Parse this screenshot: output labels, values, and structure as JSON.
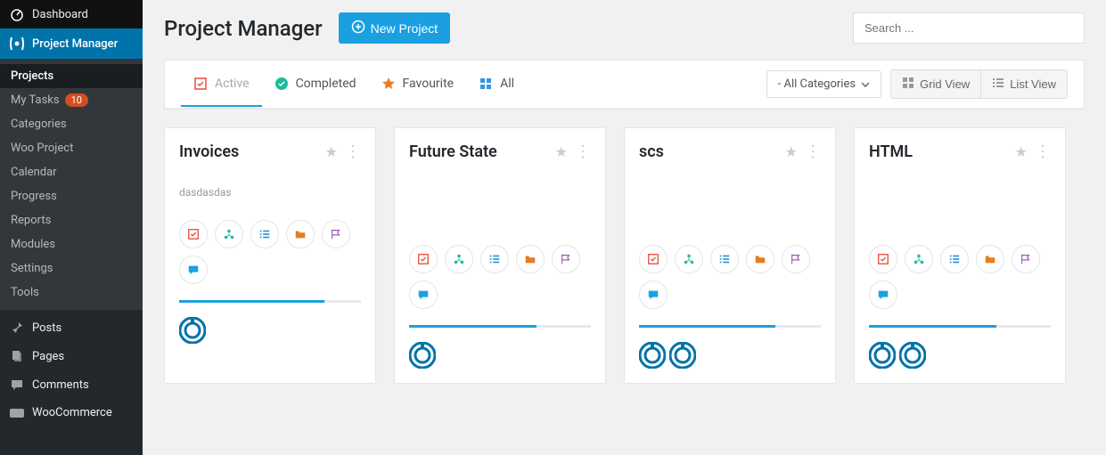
{
  "sidebar": {
    "dashboard": "Dashboard",
    "pm": "Project Manager",
    "sub": [
      {
        "label": "Projects",
        "active": true
      },
      {
        "label": "My Tasks",
        "badge": "10"
      },
      {
        "label": "Categories"
      },
      {
        "label": "Woo Project"
      },
      {
        "label": "Calendar"
      },
      {
        "label": "Progress"
      },
      {
        "label": "Reports"
      },
      {
        "label": "Modules"
      },
      {
        "label": "Settings"
      },
      {
        "label": "Tools"
      }
    ],
    "bottom": [
      {
        "label": "Posts"
      },
      {
        "label": "Pages"
      },
      {
        "label": "Comments"
      },
      {
        "label": "WooCommerce"
      }
    ]
  },
  "header": {
    "title": "Project Manager",
    "new_btn": "New Project",
    "search_placeholder": "Search ..."
  },
  "tabs": {
    "active": "Active",
    "completed": "Completed",
    "favourite": "Favourite",
    "all": "All",
    "categories": "- All Categories",
    "grid": "Grid View",
    "list": "List View"
  },
  "projects": [
    {
      "title": "Invoices",
      "desc": "dasdasdas",
      "progress": 80,
      "avatars": 1
    },
    {
      "title": "Future State",
      "desc": "",
      "progress": 70,
      "avatars": 1
    },
    {
      "title": "scs",
      "desc": "",
      "progress": 75,
      "avatars": 2
    },
    {
      "title": "HTML",
      "desc": "",
      "progress": 70,
      "avatars": 2
    }
  ],
  "icons": {
    "checkbox_color": "#e74c3c",
    "org_color": "#1abc9c",
    "list_color": "#3498db",
    "folder_color": "#e67e22",
    "flag_color": "#9b59b6",
    "chat_color": "#1aa0e0"
  }
}
